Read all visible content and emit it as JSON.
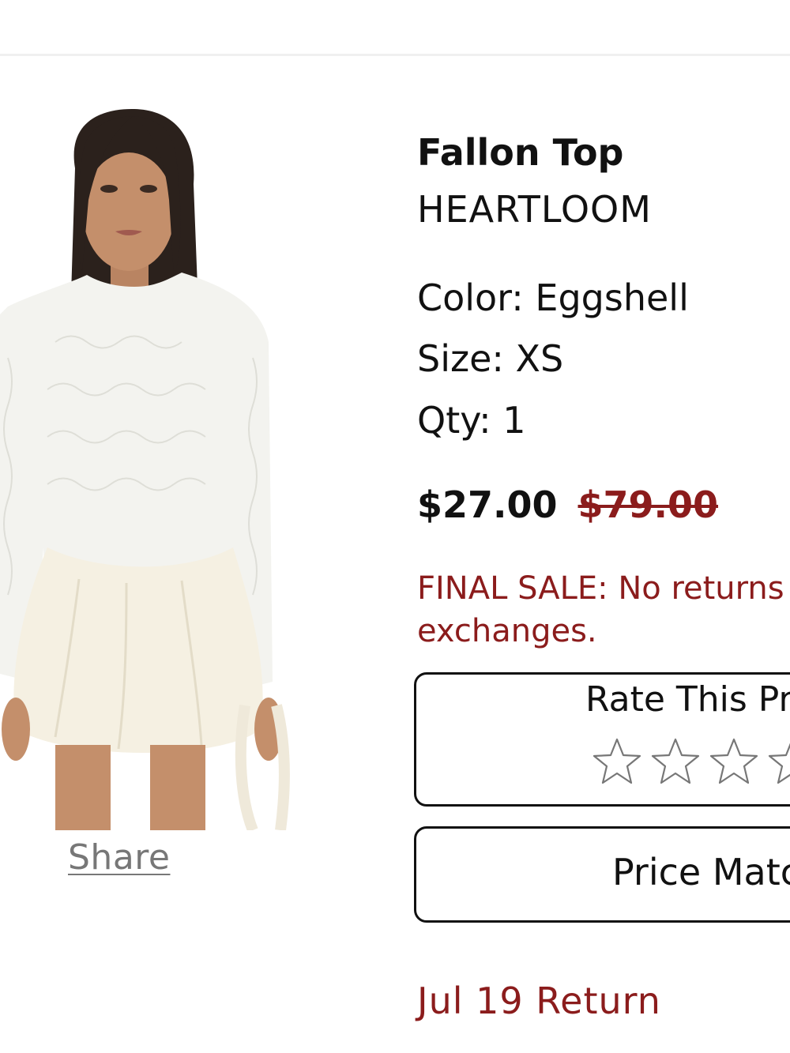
{
  "product": {
    "name": "Fallon Top",
    "brand": "HEARTLOOM",
    "color_line": "Color: Eggshell",
    "size_line": "Size: XS",
    "qty_line": "Qty: 1",
    "price_sale": "$27.00",
    "price_original": "$79.00",
    "final_sale_line1": "FINAL SALE: No returns or",
    "final_sale_line2": "exchanges.",
    "image_icon": "product-photo"
  },
  "actions": {
    "share_label": "Share",
    "rate_title": "Rate This Product",
    "star_icon": "star-outline-icon",
    "stars_total": 5,
    "stars_filled": 0,
    "price_match_label": "Price Match"
  },
  "returns": {
    "label": "Jul 19 Return"
  },
  "colors": {
    "accent_red": "#8b1c1c",
    "text": "#111111",
    "share_gray": "#777777"
  }
}
